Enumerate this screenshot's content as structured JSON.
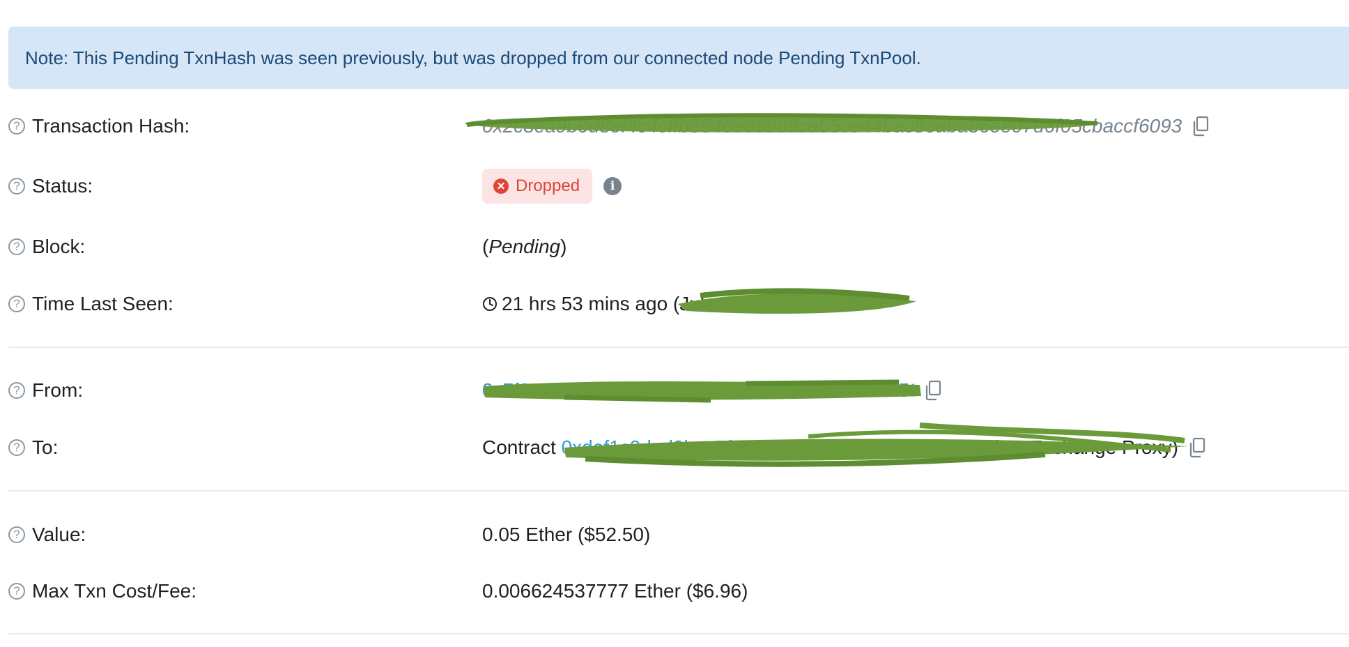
{
  "note": "Note: This Pending TxnHash was seen previously, but was dropped from our connected node Pending TxnPool.",
  "rows": {
    "tx_hash": {
      "label": "Transaction Hash:",
      "value": "0x2c8ea9b0d8ef4c4cffb5546e85909ca55ce44bac83aba86ee07d6f05cbaccf6093"
    },
    "status": {
      "label": "Status:",
      "value": "Dropped"
    },
    "block": {
      "label": "Block:",
      "open": "(",
      "value": "Pending",
      "close": ")"
    },
    "time": {
      "label": "Time Last Seen:",
      "value": "21 hrs 53 mins ago (Jul-"
    },
    "from": {
      "label": "From:",
      "value": "0x7f2a1b6c0c6b07fcd4f58a5e1b2e4c37a30c45f563"
    },
    "to": {
      "label": "To:",
      "prefix": "Contract",
      "value": "0xdef1c0ded9bec7f1a1670819833240f027b25eff",
      "suffix": "(0x: Exchange Proxy)"
    },
    "value": {
      "label": "Value:",
      "value": "0.05 Ether ($52.50)"
    },
    "fee": {
      "label": "Max Txn Cost/Fee:",
      "value": "0.006624537777 Ether ($6.96)"
    }
  },
  "icons": {
    "help": "question-circle-icon",
    "copy": "copy-icon",
    "status": "x-circle-icon",
    "info": "info-icon",
    "time": "clock-icon"
  },
  "colors": {
    "note_bg": "#d6e6f6",
    "note_text": "#1c4a78",
    "link": "#3498db",
    "dropped": "#de4437",
    "dropped_bg": "#fbe4e3",
    "redaction": "#6a9a3a"
  }
}
